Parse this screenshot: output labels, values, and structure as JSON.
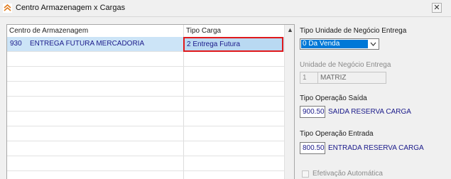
{
  "window": {
    "title": "Centro Armazenagem x Cargas",
    "close_symbol": "✕",
    "icon": "app-grid-icon"
  },
  "grid": {
    "columns": [
      "Centro de Armazenagem",
      "Tipo Carga"
    ],
    "rows": [
      {
        "code": "930",
        "name": "ENTREGA FUTURA MERCADORIA",
        "tipo_carga": "2 Entrega Futura",
        "selected": true
      }
    ],
    "empty_rows": 9
  },
  "form": {
    "tipo_unidade": {
      "label": "Tipo Unidade de Negócio Entrega",
      "value": "0 Da Venda"
    },
    "unidade": {
      "label": "Unidade de Negócio Entrega",
      "code": "1",
      "name": "MATRIZ"
    },
    "operacao_saida": {
      "label": "Tipo Operação Saída",
      "code": "900.50",
      "name": "SAIDA RESERVA CARGA"
    },
    "operacao_entrada": {
      "label": "Tipo Operação Entrada",
      "code": "800.50",
      "name": "ENTRADA RESERVA CARGA"
    },
    "efetivacao": {
      "label": "Efetivação Automática",
      "checked": false
    }
  },
  "colors": {
    "selection": "#cce4f7",
    "highlight_border": "#e0191b",
    "dropdown_selected": "#0078d7",
    "text_blue": "#1a1a8a"
  }
}
